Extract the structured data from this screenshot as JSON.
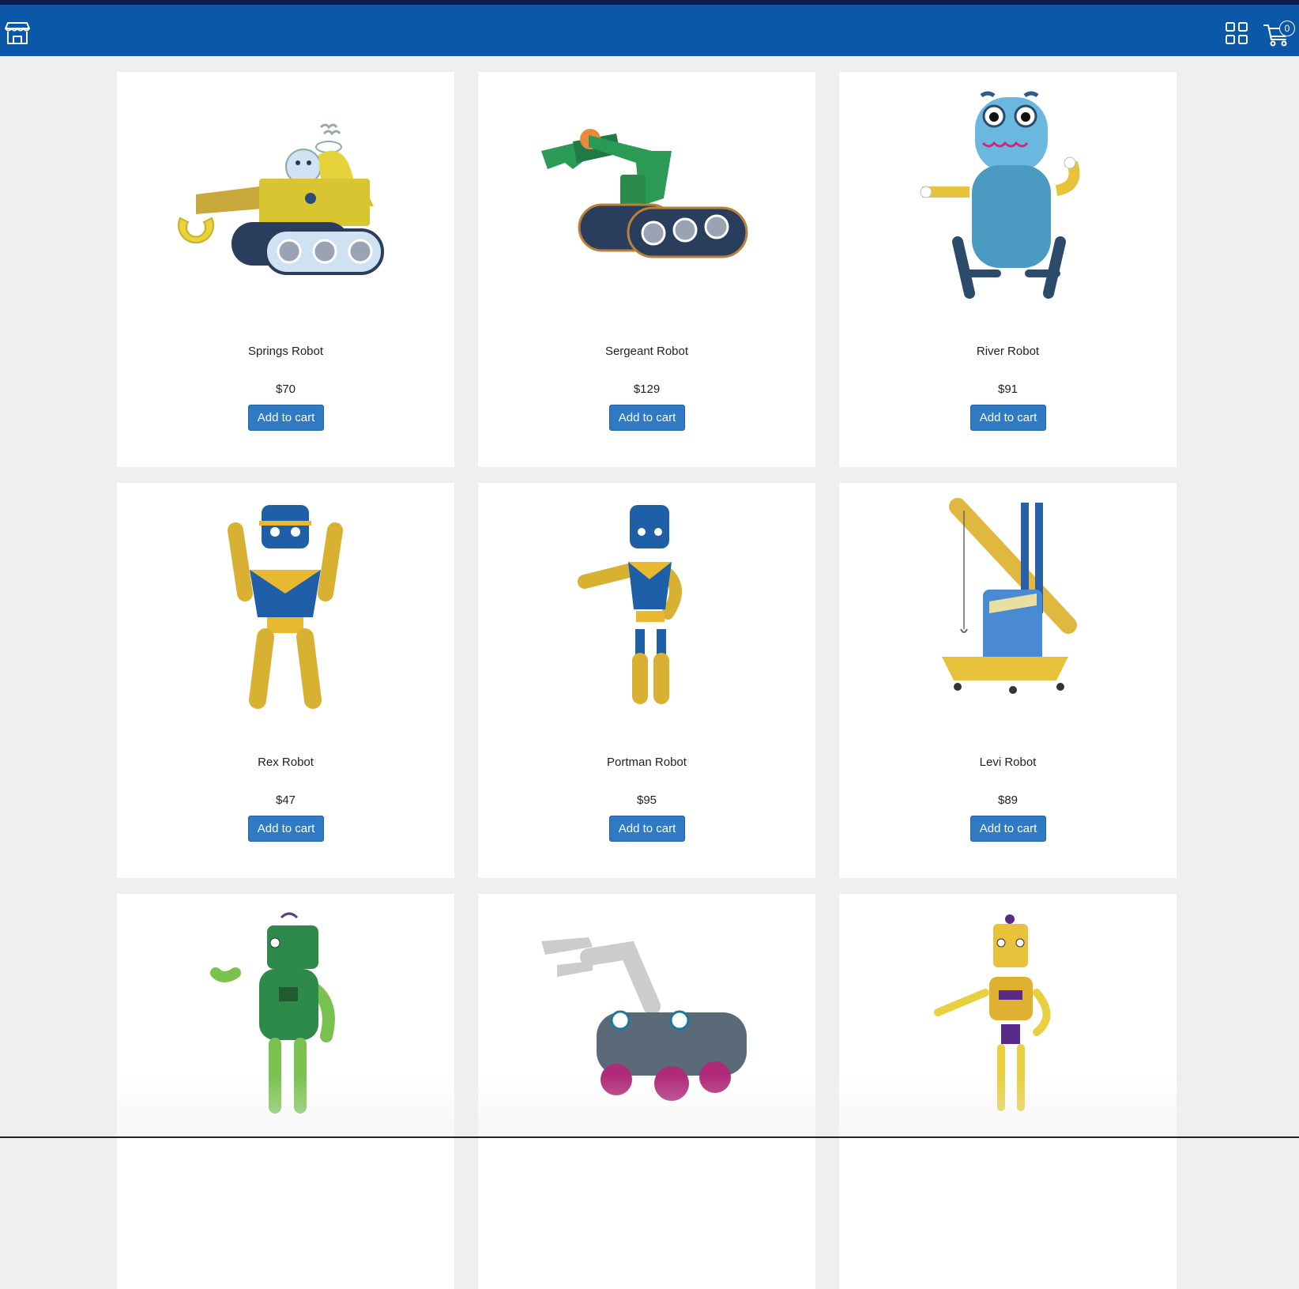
{
  "header": {
    "store_icon": "storefront-icon",
    "grid_icon": "grid-view-icon",
    "cart_icon": "shopping-cart-icon",
    "cart_count": "0",
    "brand_color": "#0b57a8"
  },
  "products": [
    {
      "name": "Springs Robot",
      "price": "$70",
      "button": "Add to cart",
      "robot": "tracked-yellow"
    },
    {
      "name": "Sergeant Robot",
      "price": "$129",
      "button": "Add to cart",
      "robot": "tracked-green"
    },
    {
      "name": "River Robot",
      "price": "$91",
      "button": "Add to cart",
      "robot": "blue-sitting"
    },
    {
      "name": "Rex Robot",
      "price": "$47",
      "button": "Add to cart",
      "robot": "blue-arms-up"
    },
    {
      "name": "Portman Robot",
      "price": "$95",
      "button": "Add to cart",
      "robot": "blue-pointing"
    },
    {
      "name": "Levi Robot",
      "price": "$89",
      "button": "Add to cart",
      "robot": "crane"
    },
    {
      "name": "",
      "price": "",
      "button": "",
      "robot": "green-humanoid"
    },
    {
      "name": "",
      "price": "",
      "button": "",
      "robot": "grey-car"
    },
    {
      "name": "",
      "price": "",
      "button": "",
      "robot": "yellow-humanoid"
    }
  ],
  "colors": {
    "button": "#2f7ac2",
    "page_background": "#efefef",
    "card_background": "#ffffff"
  }
}
